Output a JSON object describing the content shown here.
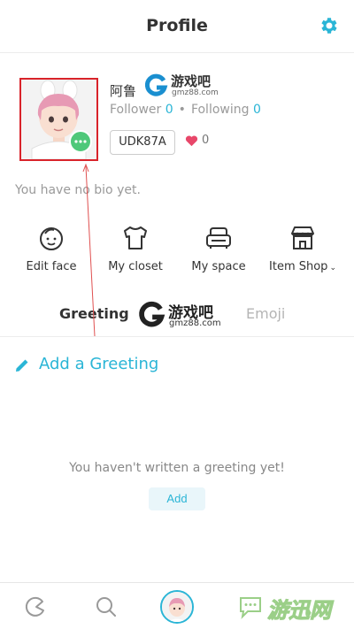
{
  "header": {
    "title": "Profile",
    "settings_icon": "gear-icon",
    "accent": "#2ab5d6"
  },
  "profile": {
    "name": "阿鲁",
    "follower_label": "Follower",
    "follower_count": "0",
    "following_label": "Following",
    "following_count": "0",
    "id_badge": "UDK87A",
    "likes": "0",
    "bio": "You have no bio yet."
  },
  "shortcuts": [
    {
      "label": "Edit face",
      "icon": "face-icon"
    },
    {
      "label": "My closet",
      "icon": "shirt-icon"
    },
    {
      "label": "My space",
      "icon": "sofa-icon"
    },
    {
      "label": "Item Shop",
      "icon": "shop-icon"
    }
  ],
  "tabs": {
    "greeting": "Greeting",
    "emoji": "Emoji"
  },
  "greeting": {
    "add_title": "Add a Greeting",
    "empty_message": "You haven't written a greeting yet!",
    "add_button": "Add"
  },
  "watermarks": {
    "site_cn": "游戏吧",
    "site_url": "gmz88.com",
    "bottom_cn": "游迅网"
  },
  "colors": {
    "highlight_box": "#d9232a",
    "heart": "#e8476a",
    "more_badge": "#4fc87a"
  }
}
